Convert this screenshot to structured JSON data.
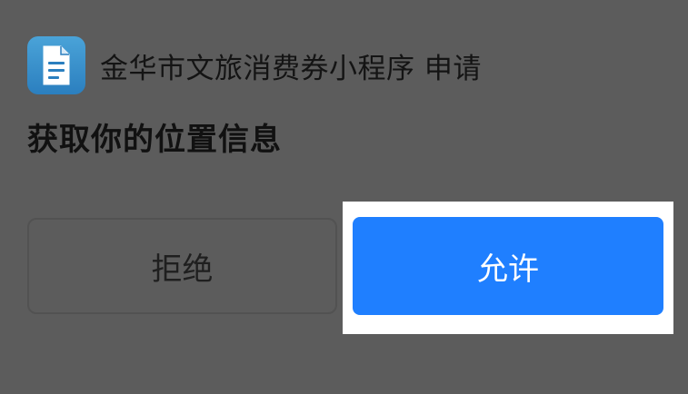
{
  "app": {
    "name": "金华市文旅消费券小程序",
    "request_suffix": "申请",
    "icon": "document-icon"
  },
  "permission": {
    "title": "获取你的位置信息"
  },
  "buttons": {
    "deny_label": "拒绝",
    "allow_label": "允许"
  },
  "colors": {
    "overlay_bg": "#5c5c5c",
    "allow_button": "#1f7fff",
    "allow_text": "#ffffff",
    "icon_gradient_top": "#4aa3d8",
    "icon_gradient_bottom": "#2b7fbf"
  }
}
